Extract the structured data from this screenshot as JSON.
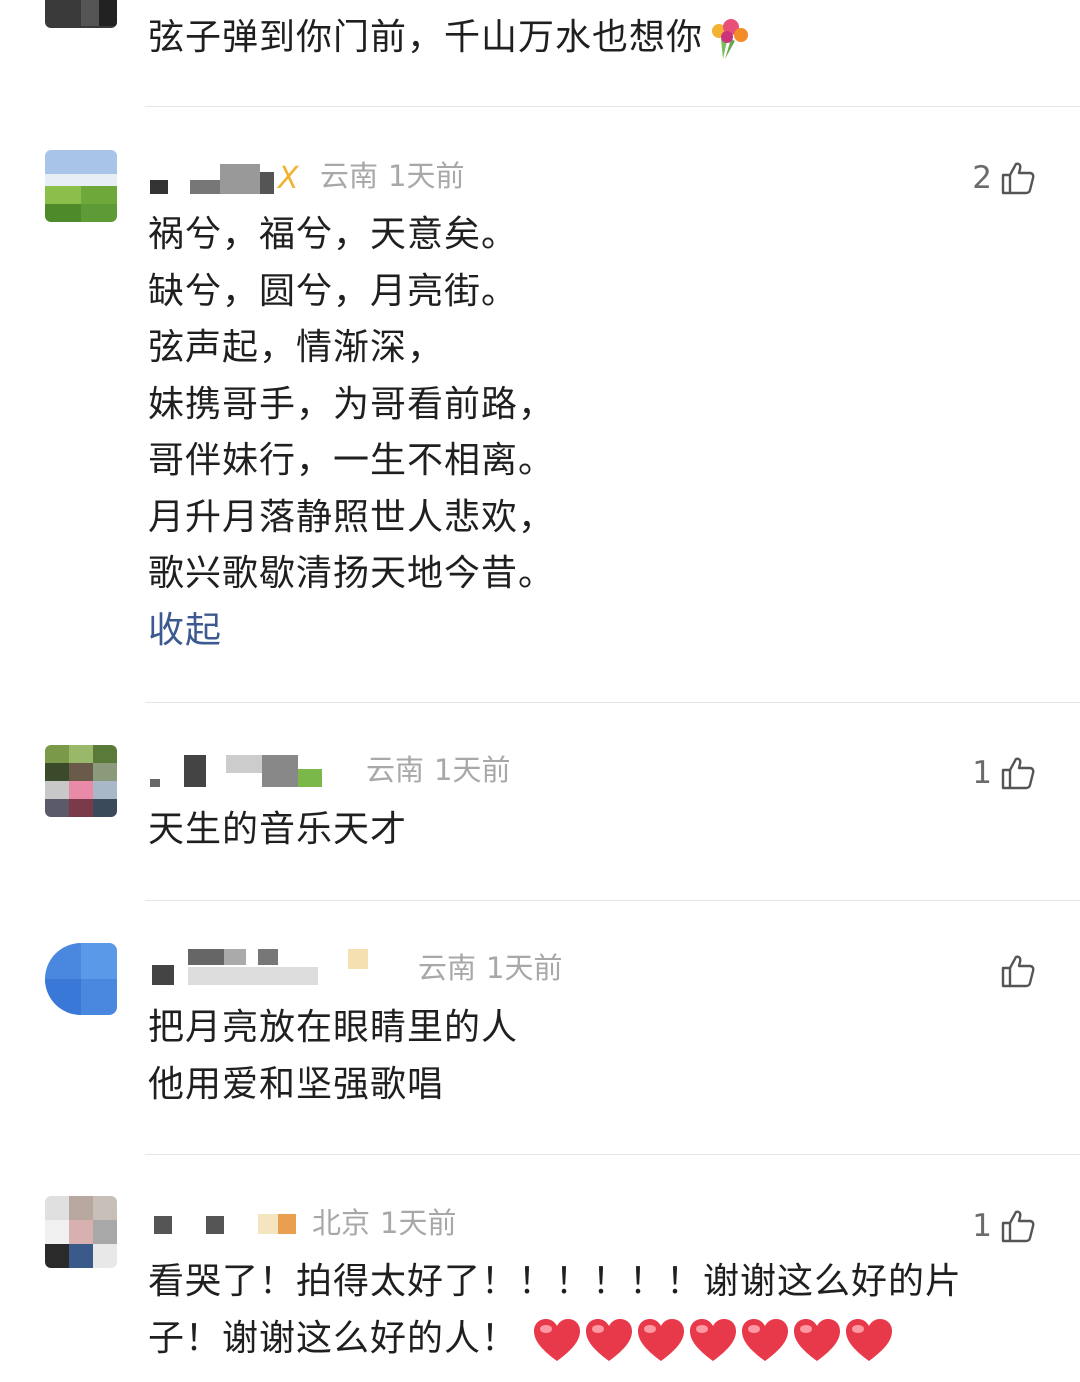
{
  "comments": [
    {
      "text_lines": [
        "弦子弹到你门前，千山万水也想你"
      ],
      "emoji": "bouquet"
    },
    {
      "location": "云南",
      "time": "1天前",
      "likes": "2",
      "text_lines": [
        "祸兮，福兮，天意矣。",
        "缺兮，圆兮，月亮街。",
        "弦声起，情渐深，",
        "妹携哥手，为哥看前路，",
        "哥伴妹行，一生不相离。",
        "月升月落静照世人悲欢，",
        "歌兴歌歇清扬天地今昔。"
      ],
      "collapse_label": "收起"
    },
    {
      "location": "云南",
      "time": "1天前",
      "likes": "1",
      "text_lines": [
        "天生的音乐天才"
      ]
    },
    {
      "location": "云南",
      "time": "1天前",
      "likes": "",
      "text_lines": [
        "把月亮放在眼睛里的人",
        "他用爱和坚强歌唱"
      ]
    },
    {
      "location": "北京",
      "time": "1天前",
      "likes": "1",
      "text_lines": [
        "看哭了！拍得太好了！！！！！！谢谢这么好的片",
        "子！谢谢这么好的人！"
      ],
      "emoji_count": 7
    }
  ],
  "icons": {
    "like": "thumbs-up-icon",
    "heart": "red-heart-icon",
    "bouquet": "bouquet-icon"
  },
  "colors": {
    "meta_text": "#a8a8a8",
    "collapse_link": "#3c5a8f",
    "heart": "#e8394a"
  }
}
